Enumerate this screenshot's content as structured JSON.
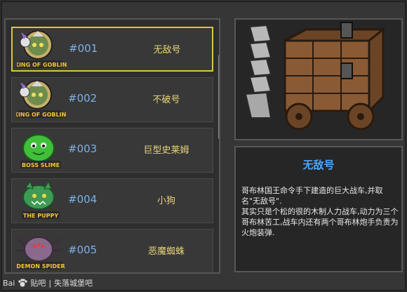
{
  "units": [
    {
      "number": "#001",
      "name": "无敌号",
      "badge": "KING OF GOBLIN",
      "selected": true,
      "colors": {
        "skin": "#5f8d3a",
        "bg": "#c9b06a"
      }
    },
    {
      "number": "#002",
      "name": "不破号",
      "badge": "KING OF GOBLIN",
      "selected": false,
      "colors": {
        "skin": "#5f8d3a",
        "bg": "#c9b06a"
      }
    },
    {
      "number": "#003",
      "name": "巨型史莱姆",
      "badge": "BOSS SLIME",
      "selected": false,
      "colors": {
        "skin": "#3fbf3a",
        "bg": "#2f2f2f"
      }
    },
    {
      "number": "#004",
      "name": "小狗",
      "badge": "THE PUPPY",
      "selected": false,
      "colors": {
        "skin": "#3f9a53",
        "bg": "#2f2f2f"
      }
    },
    {
      "number": "#005",
      "name": "恶魔蜘蛛",
      "badge": "DEMON SPIDER",
      "selected": false,
      "colors": {
        "skin": "#8a6a8c",
        "bg": "#2f2f2f"
      }
    }
  ],
  "detail": {
    "title": "无敌号",
    "description": "哥布林国王命令手下建造的巨大战车,并取名\"无敌号\".\n其实只是个松的很的木制人力战车,动力为三个哥布林苦工,战车内还有两个哥布林炮手负责为火炮装弹."
  },
  "watermark": {
    "brand": "Bai",
    "brand_suffix": "贴吧",
    "forum": "失落城堡吧"
  },
  "theme": {
    "highlight": "#d9c93a",
    "number_color": "#7db0e8",
    "name_color": "#e8d37a",
    "title_color": "#4fa6ff"
  }
}
